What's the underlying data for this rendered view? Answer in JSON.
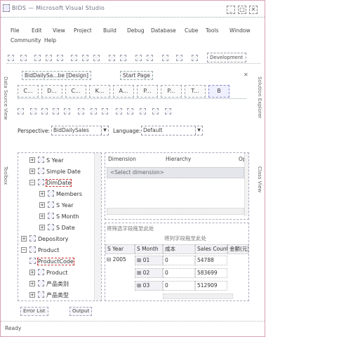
{
  "window": {
    "title": "BIDS — Microsoft Visual Studio",
    "buttons": {
      "minimize": "_",
      "maximize": "□",
      "close": "✕"
    }
  },
  "menu": [
    "File",
    "Edit",
    "View",
    "Project",
    "Build",
    "Debug",
    "Database",
    "Cube",
    "Tools",
    "Window",
    "Community",
    "Help"
  ],
  "toolbar": {
    "config": "Development"
  },
  "side_panels": {
    "left_top": "Data Source View",
    "left_bottom": "Toolbox",
    "right_top": "Solution Explorer",
    "right_bottom": "Class View"
  },
  "doc_tabs": [
    "BidDailySa...be [Design]",
    "Start Page"
  ],
  "doc_close": "✕",
  "designer_tabs": [
    "C...",
    "D...",
    "C...",
    "K...",
    "A...",
    "P...",
    "P...",
    "T...",
    "B"
  ],
  "perspective": {
    "label": "Perspective:",
    "value": "BidDailySales",
    "language_label": "Language:",
    "language_value": "Default"
  },
  "tree": [
    {
      "label": "S Year",
      "exp": "+"
    },
    {
      "label": "Simple Date",
      "exp": "+"
    },
    {
      "label": "DimDate",
      "exp": "−"
    },
    {
      "label": "Members",
      "exp": "+"
    },
    {
      "label": "S Year",
      "exp": "+"
    },
    {
      "label": "S Month",
      "exp": "+"
    },
    {
      "label": "S Date",
      "exp": "+"
    },
    {
      "label": "Depository",
      "exp": "+"
    },
    {
      "label": "Product",
      "exp": "−"
    },
    {
      "label": "ProductCode",
      "exp": ""
    },
    {
      "label": "Product",
      "exp": "+"
    },
    {
      "label": "产品类别",
      "exp": "+"
    },
    {
      "label": "产品类型",
      "exp": "+"
    }
  ],
  "grid": {
    "headers": [
      "Dimension",
      "Hierarchy",
      "Op"
    ],
    "placeholder": "<Select dimension>"
  },
  "pivot": {
    "filter_hint": "将筛选字段拖至此处",
    "column_hint": "将列字段拖至此处",
    "row_headers": [
      "S Year",
      "S Month",
      "成本",
      "Sales Count",
      "金额(元)"
    ],
    "year": "2005",
    "rows": [
      {
        "month": "01",
        "cost": "0",
        "count": "54788"
      },
      {
        "month": "02",
        "cost": "0",
        "count": "583699"
      },
      {
        "month": "03",
        "cost": "0",
        "count": "512909"
      }
    ]
  },
  "bottom_tabs": [
    "Error List",
    "Output"
  ],
  "status": "Ready"
}
